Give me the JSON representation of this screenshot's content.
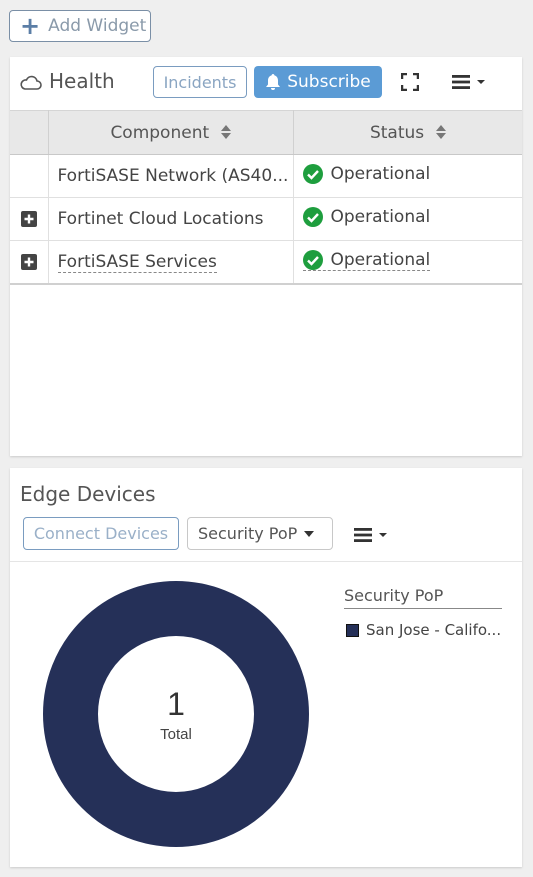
{
  "toolbar": {
    "add_widget_label": "Add Widget"
  },
  "health": {
    "title": "Health",
    "incidents_label": "Incidents",
    "subscribe_label": "Subscribe",
    "columns": [
      "Component",
      "Status"
    ],
    "rows": [
      {
        "component": "FortiSASE Network (AS40...",
        "status": "Operational",
        "expandable": false
      },
      {
        "component": "Fortinet Cloud Locations",
        "status": "Operational",
        "expandable": true
      },
      {
        "component": "FortiSASE Services",
        "status": "Operational",
        "expandable": true
      }
    ]
  },
  "edge": {
    "title": "Edge Devices",
    "connect_label": "Connect Devices",
    "dropdown_value": "Security PoP",
    "legend_title": "Security PoP",
    "total_value": "1",
    "total_label": "Total"
  },
  "colors": {
    "accent": "#5b9bd5",
    "donut": "#253058",
    "status_ok": "#1e9e3e"
  },
  "chart_data": {
    "type": "pie",
    "categories": [
      "San Jose - Califo..."
    ],
    "values": [
      1
    ],
    "title": "",
    "legend_title": "Security PoP",
    "center_value": "1",
    "center_label": "Total"
  }
}
